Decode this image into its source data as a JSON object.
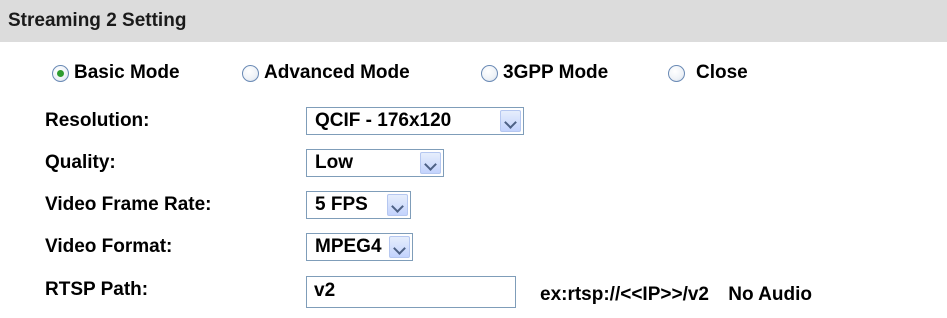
{
  "section": {
    "title": "Streaming 2 Setting"
  },
  "modes": [
    {
      "label": "Basic Mode",
      "checked": true
    },
    {
      "label": "Advanced Mode",
      "checked": false
    },
    {
      "label": "3GPP Mode",
      "checked": false
    },
    {
      "label": "Close",
      "checked": false
    }
  ],
  "fields": {
    "resolution": {
      "label": "Resolution:",
      "value": "QCIF - 176x120"
    },
    "quality": {
      "label": "Quality:",
      "value": "Low"
    },
    "frame_rate": {
      "label": "Video Frame Rate:",
      "value": "5 FPS"
    },
    "format": {
      "label": "Video Format:",
      "value": "MPEG4"
    },
    "rtsp": {
      "label": "RTSP Path:",
      "value": "v2",
      "hint": "ex:rtsp://<<IP>>/v2",
      "audio_note": "No Audio"
    }
  },
  "colors": {
    "title_bar": "#dcdcdc",
    "radio_selected": "#2e9c2e",
    "input_border": "#7f9db9"
  }
}
